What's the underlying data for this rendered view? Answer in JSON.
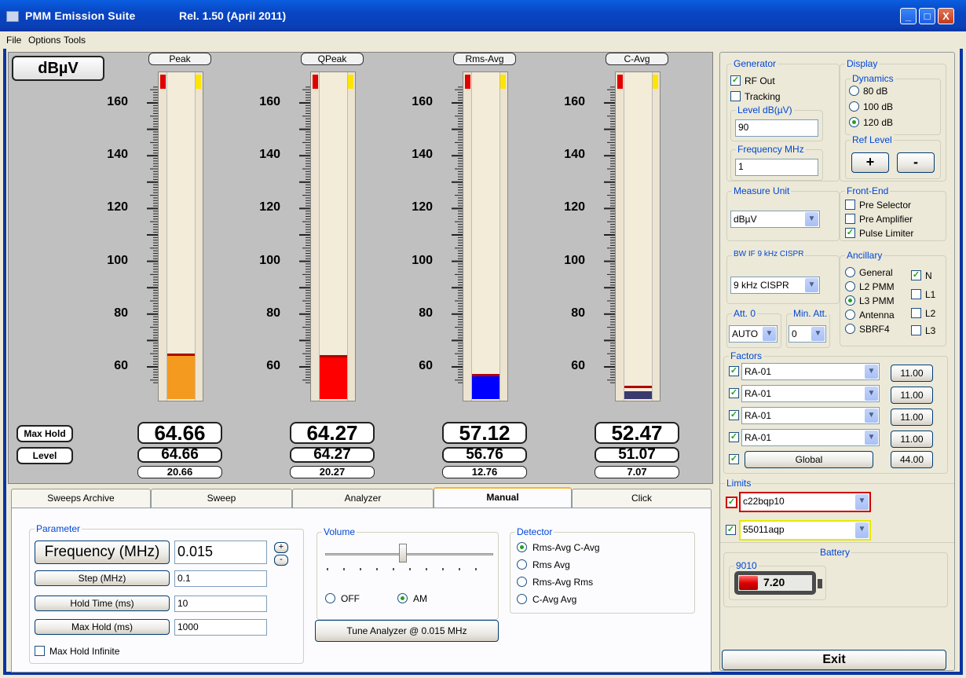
{
  "window": {
    "title": "PMM Emission Suite",
    "release": "Rel. 1.50 (April 2011)",
    "minimize": "_",
    "maximize": "□",
    "close": "X"
  },
  "menu": [
    "File",
    "Options",
    "Tools"
  ],
  "meter": {
    "unit": "dBµV",
    "scale_labels": [
      "160",
      "140",
      "120",
      "100",
      "80",
      "60"
    ],
    "max_hold_label": "Max Hold",
    "level_label": "Level",
    "channels": [
      {
        "name": "Peak",
        "max_hold": "64.66",
        "level": "64.66",
        "delta": "20.66",
        "color": "#f49a1e",
        "value": 64.66
      },
      {
        "name": "QPeak",
        "max_hold": "64.27",
        "level": "64.27",
        "delta": "20.27",
        "color": "#ff0000",
        "value": 64.27
      },
      {
        "name": "Rms-Avg",
        "max_hold": "57.12",
        "level": "56.76",
        "delta": "12.76",
        "color": "#0000ff",
        "value": 56.76
      },
      {
        "name": "C-Avg",
        "max_hold": "52.47",
        "level": "51.07",
        "delta": "7.07",
        "color": "#3a3a6e",
        "value": 51.07
      }
    ]
  },
  "tabs": [
    "Sweeps Archive",
    "Sweep",
    "Analyzer",
    "Manual",
    "Click"
  ],
  "manual": {
    "parameter": {
      "title": "Parameter",
      "frequency_label": "Frequency (MHz)",
      "frequency_value": "0.015",
      "plus": "+",
      "minus": "-",
      "step_label": "Step (MHz)",
      "step_value": "0.1",
      "hold_time_label": "Hold Time (ms)",
      "hold_time_value": "10",
      "max_hold_label": "Max Hold (ms)",
      "max_hold_value": "1000",
      "max_hold_infinite": "Max Hold Infinite"
    },
    "volume": {
      "title": "Volume",
      "off": "OFF",
      "am": "AM"
    },
    "tune_button": "Tune Analyzer @ 0.015 MHz",
    "detector": {
      "title": "Detector",
      "options": [
        "Rms-Avg  C-Avg",
        "Rms  Avg",
        "Rms-Avg  Rms",
        "C-Avg  Avg"
      ]
    }
  },
  "right": {
    "generator": {
      "title": "Generator",
      "rf_out": "RF Out",
      "tracking": "Tracking",
      "level_label": "Level dB(µV)",
      "level_value": "90",
      "freq_label": "Frequency MHz",
      "freq_value": "1"
    },
    "display": {
      "title": "Display",
      "dynamics_title": "Dynamics",
      "dynamics": [
        "80 dB",
        "100 dB",
        "120 dB"
      ],
      "ref_level_title": "Ref Level",
      "plus": "+",
      "minus": "-"
    },
    "measure_unit": {
      "title": "Measure Unit",
      "value": "dBµV"
    },
    "front_end": {
      "title": "Front-End",
      "items": [
        "Pre Selector",
        "Pre Amplifier",
        "Pulse Limiter"
      ]
    },
    "bw": {
      "title": "BW IF 9 kHz CISPR",
      "value": "9 kHz CISPR"
    },
    "ancillary": {
      "title": "Ancillary",
      "radios": [
        "General",
        "L2 PMM",
        "L3 PMM",
        "Antenna",
        "SBRF4"
      ],
      "checks": [
        "N",
        "L1",
        "L2",
        "L3"
      ]
    },
    "att": {
      "title": "Att. 0",
      "value": "AUTO"
    },
    "min_att": {
      "title": "Min. Att.",
      "value": "0"
    },
    "factors": {
      "title": "Factors",
      "rows": [
        {
          "name": "RA-01",
          "value": "11.00"
        },
        {
          "name": "RA-01",
          "value": "11.00"
        },
        {
          "name": "RA-01",
          "value": "11.00"
        },
        {
          "name": "RA-01",
          "value": "11.00"
        }
      ],
      "global_label": "Global",
      "global_value": "44.00"
    },
    "limits": {
      "title": "Limits",
      "items": [
        "c22bqp10",
        "55011aqp"
      ]
    },
    "battery": {
      "title": "Battery",
      "device": "9010",
      "value": "7.20"
    },
    "exit": "Exit"
  }
}
